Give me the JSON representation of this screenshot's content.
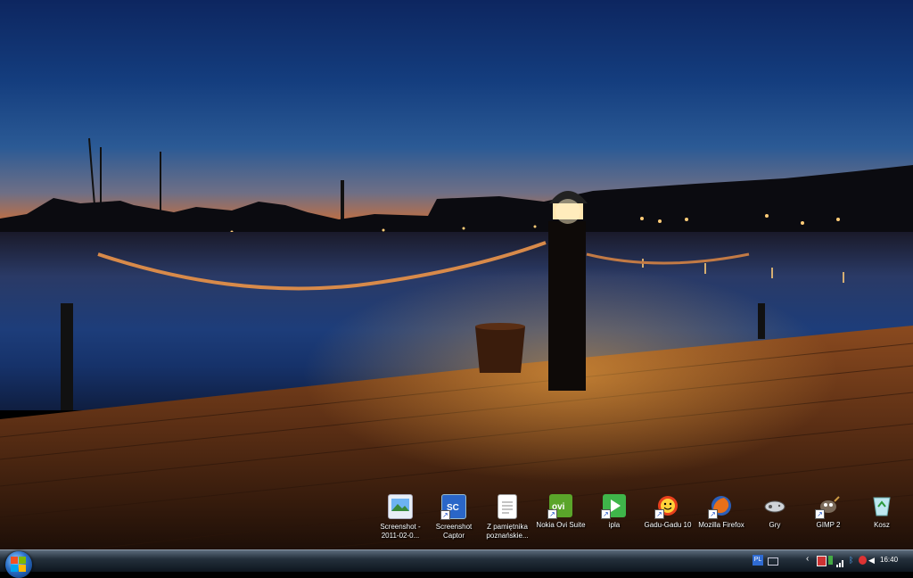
{
  "desktop": {
    "icons": [
      {
        "label": "Screenshot - 2011-02-0...",
        "icon": "image-file-icon"
      },
      {
        "label": "Screenshot Captor",
        "icon": "screenshot-captor-icon"
      },
      {
        "label": "Z pamiętnika poznańskie...",
        "icon": "document-icon"
      },
      {
        "label": "Nokia Ovi Suite",
        "icon": "ovi-icon"
      },
      {
        "label": "ipla",
        "icon": "ipla-play-icon"
      },
      {
        "label": "Gadu-Gadu 10",
        "icon": "gadu-gadu-sun-icon"
      },
      {
        "label": "Mozilla Firefox",
        "icon": "firefox-icon"
      },
      {
        "label": "Gry",
        "icon": "games-controller-icon"
      },
      {
        "label": "GIMP 2",
        "icon": "gimp-icon"
      },
      {
        "label": "Kosz",
        "icon": "recycle-bin-icon"
      }
    ]
  },
  "taskbar": {
    "language": "PL",
    "clock": "16:40"
  },
  "colors": {
    "sky_top": "#0d2660",
    "sunset": "#e2873d",
    "dock_wood": "#6b3a1c",
    "lamp_glow": "#ffb347"
  }
}
